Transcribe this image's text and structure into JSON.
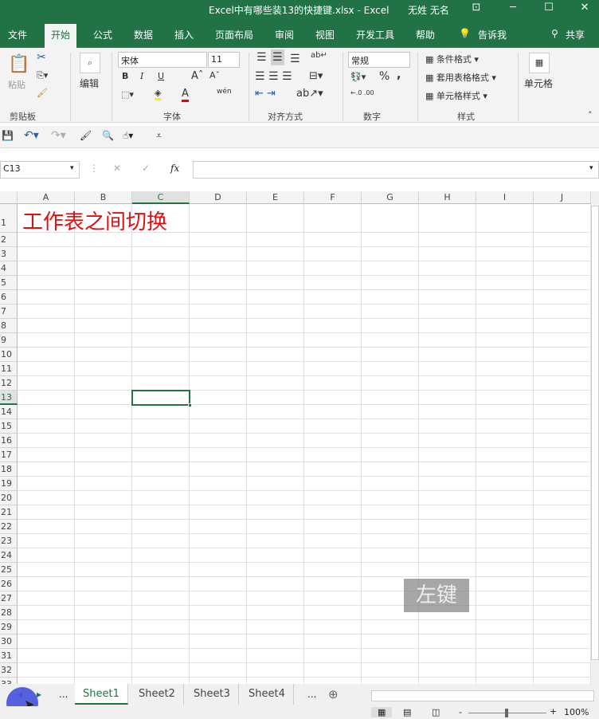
{
  "window": {
    "title": "Excel中有哪些装13的快捷键.xlsx  -  Excel",
    "user": "无姓 无名"
  },
  "menu": [
    "文件",
    "开始",
    "公式",
    "数据",
    "插入",
    "页面布局",
    "审阅",
    "视图",
    "开发工具",
    "帮助"
  ],
  "tell_me": "告诉我",
  "share": "共享",
  "ribbon": {
    "clipboard": {
      "paste": "粘贴",
      "group": "剪贴板"
    },
    "edit": "编辑",
    "font": {
      "name": "宋体",
      "size": "11",
      "bold": "B",
      "italic": "I",
      "underline": "U",
      "group": "字体",
      "phonetic": "wén"
    },
    "align": {
      "group": "对齐方式"
    },
    "number": {
      "format": "常规",
      "percent": "%",
      "comma": ",",
      "group": "数字"
    },
    "styles": {
      "cond": "条件格式",
      "table": "套用表格格式",
      "cell": "单元格样式",
      "group": "样式"
    },
    "cells": "单元格"
  },
  "formula": {
    "name_box": "C13",
    "fx": "fx",
    "value": ""
  },
  "columns": [
    "A",
    "B",
    "C",
    "D",
    "E",
    "F",
    "G",
    "H",
    "I",
    "J"
  ],
  "rows": 32,
  "cell_A1": "工作表之间切换",
  "active_cell": "C13",
  "overlay": "左键",
  "sheets": [
    "Sheet1",
    "Sheet2",
    "Sheet3",
    "Sheet4"
  ],
  "active_sheet": "Sheet1",
  "more": "...",
  "zoom": "100%"
}
